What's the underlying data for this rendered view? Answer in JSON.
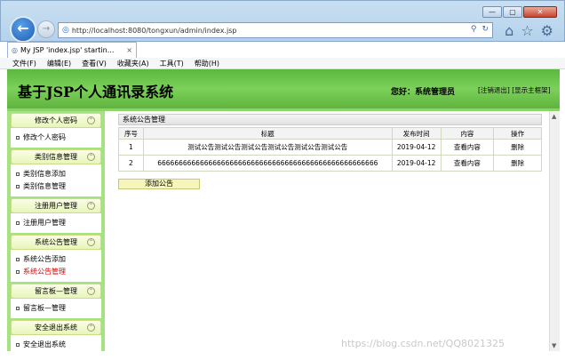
{
  "browser": {
    "address_url": "http://localhost:8080/tongxun/admin/index.jsp",
    "tab_title": "My JSP 'index.jsp' startin...",
    "window_buttons": [
      "—",
      "▢",
      "✕"
    ],
    "menu": [
      "文件(F)",
      "编辑(E)",
      "查看(V)",
      "收藏夹(A)",
      "工具(T)",
      "帮助(H)"
    ]
  },
  "header": {
    "title": "基于JSP个人通讯录系统",
    "greeting": "您好：系统管理员",
    "logout_link": "[注销退出]",
    "home_link": "[显示主框架]"
  },
  "sidebar": {
    "groups": [
      {
        "title": "修改个人密码",
        "items": [
          {
            "label": "修改个人密码",
            "active": false
          }
        ]
      },
      {
        "title": "类别信息管理",
        "items": [
          {
            "label": "类别信息添加",
            "active": false
          },
          {
            "label": "类别信息管理",
            "active": false
          }
        ]
      },
      {
        "title": "注册用户管理",
        "items": [
          {
            "label": "注册用户管理",
            "active": false
          }
        ]
      },
      {
        "title": "系统公告管理",
        "items": [
          {
            "label": "系统公告添加",
            "active": false
          },
          {
            "label": "系统公告管理",
            "active": true
          }
        ]
      },
      {
        "title": "留言板—管理",
        "items": [
          {
            "label": "留言板—管理",
            "active": false
          }
        ]
      },
      {
        "title": "安全退出系统",
        "items": [
          {
            "label": "安全退出系统",
            "active": false
          }
        ]
      }
    ]
  },
  "content": {
    "panel_title": "系统公告管理",
    "columns": [
      "序号",
      "标题",
      "发布时间",
      "内容",
      "操作"
    ],
    "rows": [
      {
        "no": "1",
        "title": "测试公告测试公告测试公告测试公告测试公告测试公告",
        "date": "2019-04-12",
        "view": "查看内容",
        "action": "删除"
      },
      {
        "no": "2",
        "title": "6666666666666666666666666666666666666666666666666666",
        "date": "2019-04-12",
        "view": "查看内容",
        "action": "删除"
      }
    ],
    "add_button": "添加公告"
  },
  "watermark": "https://blog.csdn.net/QQ8021325"
}
